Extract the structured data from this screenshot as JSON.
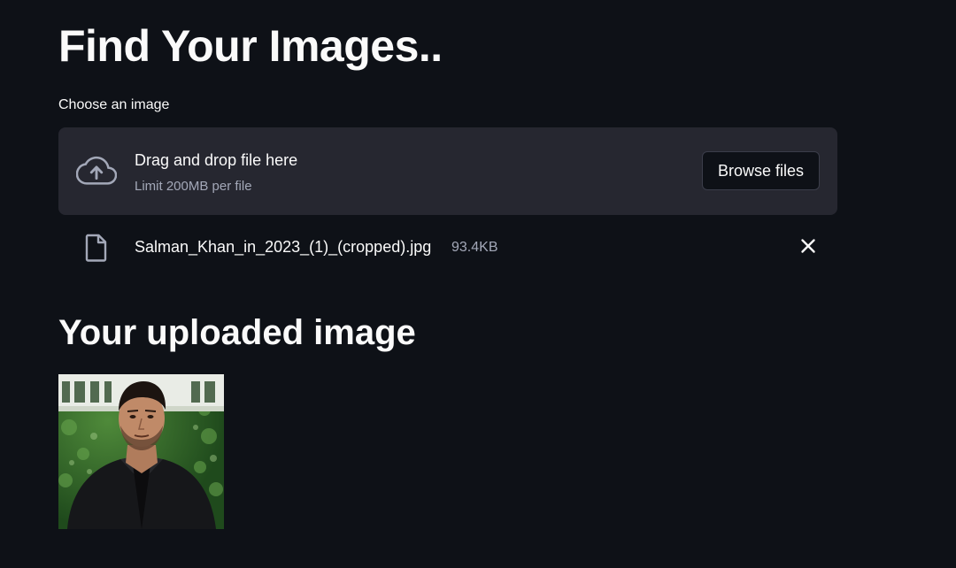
{
  "page": {
    "title": "Find Your Images..",
    "subtitle": "Your uploaded image"
  },
  "uploader": {
    "label": "Choose an image",
    "drag_text": "Drag and drop file here",
    "limit_text": "Limit 200MB per file",
    "browse_label": "Browse files",
    "icon": "cloud-upload-icon"
  },
  "uploaded_file": {
    "name": "Salman_Khan_in_2023_(1)_(cropped).jpg",
    "size": "93.4KB",
    "icon": "file-icon",
    "remove_icon": "close-icon"
  },
  "colors": {
    "background": "#0e1117",
    "dropzone": "#262730",
    "text": "#fafafa",
    "muted_text": "#a3a8b8"
  }
}
